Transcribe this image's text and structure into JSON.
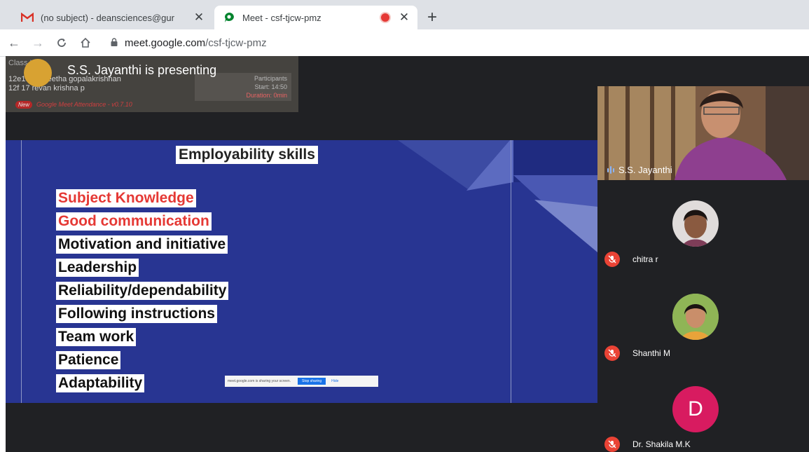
{
  "browser": {
    "tabs": [
      {
        "title": "(no subject) - deansciences@gur",
        "icon": "gmail-icon"
      },
      {
        "title": "Meet - csf-tjcw-pmz",
        "icon": "meet-icon",
        "recording": true,
        "active": true
      }
    ],
    "url_domain": "meet.google.com",
    "url_path": "/csf-tjcw-pmz"
  },
  "meet": {
    "presenter_banner": "S.S. Jayanthi is presenting",
    "extension": {
      "header": "Class List",
      "rows": [
        "12e18 praneetha gopalakrishnan",
        "12f 17 revan krishna p"
      ],
      "stats": [
        "Participants",
        "Start: 14:50",
        "Duration: 0min"
      ],
      "badge": "New",
      "footer": "Google Meet Attendance - v0.7.10"
    },
    "slide": {
      "title": "Employability skills",
      "skills": [
        {
          "text": "Subject  Knowledge",
          "color": "#e53935"
        },
        {
          "text": "Good communication",
          "color": "#e53935"
        },
        {
          "text": "Motivation and initiative",
          "color": "#111111"
        },
        {
          "text": "Leadership",
          "color": "#111111"
        },
        {
          "text": "Reliability/dependability",
          "color": "#111111"
        },
        {
          "text": "Following instructions",
          "color": "#111111"
        },
        {
          "text": "Team work",
          "color": "#111111"
        },
        {
          "text": "Patience",
          "color": "#111111"
        },
        {
          "text": "Adaptability",
          "color": "#111111"
        }
      ],
      "share_notice": "meet.google.com is sharing your screen.",
      "stop_sharing": "Stop sharing",
      "hide": "Hide"
    },
    "participants": [
      {
        "name": "S.S. Jayanthi",
        "speaking": true
      },
      {
        "name": "chitra r",
        "muted": true
      },
      {
        "name": "Shanthi M",
        "muted": true
      },
      {
        "name": "Dr. Shakila M.K",
        "muted": true,
        "initial": "D",
        "avatar_color": "#d81b60"
      }
    ]
  }
}
